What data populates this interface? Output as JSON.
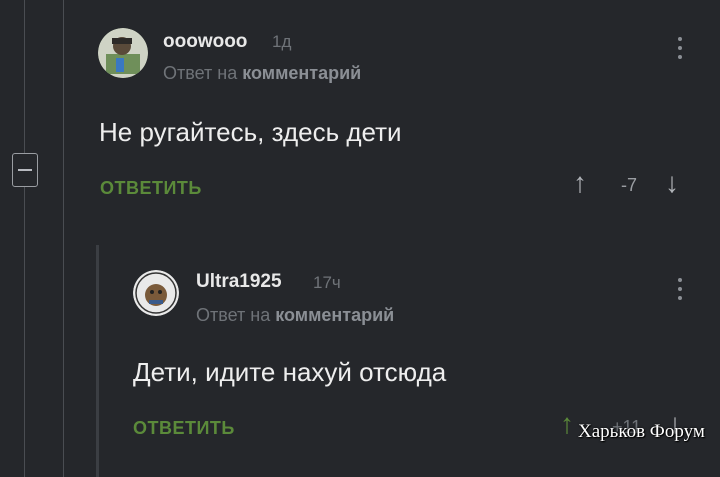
{
  "comment1": {
    "username": "ooowooo",
    "time": "1д",
    "reply_prefix": "Ответ на",
    "reply_target": "комментарий",
    "text": "Не ругайтесь, здесь дети",
    "reply_label": "ОТВЕТИТЬ",
    "score": "-7"
  },
  "comment2": {
    "username": "Ultra1925",
    "time": "17ч",
    "reply_prefix": "Ответ на",
    "reply_target": "комментарий",
    "text": "Дети, идите нахуй отсюда",
    "reply_label": "ОТВЕТИТЬ",
    "score": "+11"
  },
  "watermark": "Харьков Форум",
  "colors": {
    "background": "#25272b",
    "reply_green": "#5b8a3a",
    "muted_text": "#6f7378"
  }
}
